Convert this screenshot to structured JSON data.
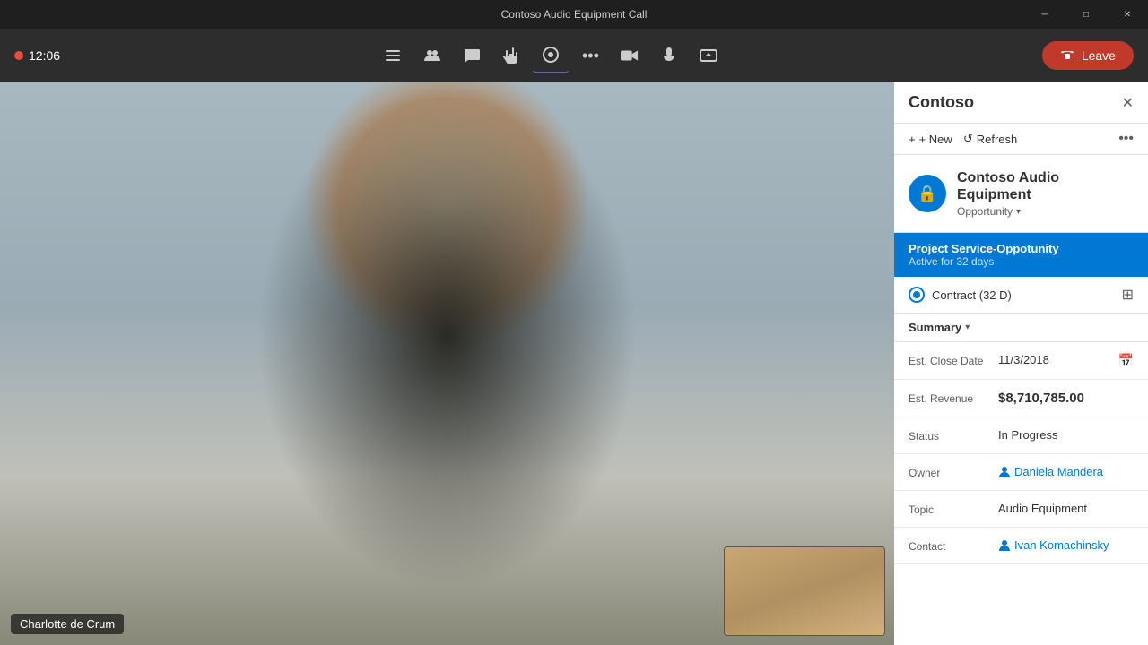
{
  "titleBar": {
    "title": "Contoso Audio Equipment Call"
  },
  "windowControls": {
    "minimize": "─",
    "maximize": "□",
    "close": "✕"
  },
  "callToolbar": {
    "timer": "12:06",
    "buttons": [
      {
        "id": "roster",
        "icon": "≡",
        "label": "Roster"
      },
      {
        "id": "participants",
        "icon": "👥",
        "label": "Participants"
      },
      {
        "id": "chat",
        "icon": "💬",
        "label": "Chat"
      },
      {
        "id": "raise-hand",
        "icon": "✋",
        "label": "Raise Hand"
      },
      {
        "id": "blur",
        "icon": "⊙",
        "label": "Background"
      },
      {
        "id": "more",
        "icon": "•••",
        "label": "More"
      }
    ],
    "mediaButtons": [
      {
        "id": "camera",
        "icon": "📷",
        "label": "Camera"
      },
      {
        "id": "microphone",
        "icon": "🎤",
        "label": "Microphone"
      },
      {
        "id": "share",
        "icon": "↑",
        "label": "Share"
      }
    ],
    "leaveButton": "Leave"
  },
  "mainVideo": {
    "participantName": "Charlotte de Crum"
  },
  "sidePanel": {
    "title": "Contoso",
    "closeButton": "✕",
    "actions": {
      "new": "+ New",
      "refresh": "↺ Refresh",
      "more": "•••"
    },
    "recordCard": {
      "icon": "🔒",
      "name": "Contoso Audio Equipment",
      "type": "Opportunity"
    },
    "projectBanner": {
      "title": "Project Service-Oppotunity",
      "subtitle": "Active for 32 days"
    },
    "contractRow": {
      "text": "Contract (32 D)"
    },
    "summary": {
      "label": "Summary"
    },
    "fields": [
      {
        "id": "est-close-date",
        "label": "Est. Close Date",
        "value": "11/3/2018",
        "type": "date"
      },
      {
        "id": "est-revenue",
        "label": "Est. Revenue",
        "value": "$8,710,785.00",
        "type": "large"
      },
      {
        "id": "status",
        "label": "Status",
        "value": "In Progress",
        "type": "normal"
      },
      {
        "id": "owner",
        "label": "Owner",
        "value": "Daniela Mandera",
        "type": "link"
      },
      {
        "id": "topic",
        "label": "Topic",
        "value": "Audio Equipment",
        "type": "normal"
      },
      {
        "id": "contact",
        "label": "Contact",
        "value": "Ivan Komachinsky",
        "type": "link"
      }
    ]
  }
}
